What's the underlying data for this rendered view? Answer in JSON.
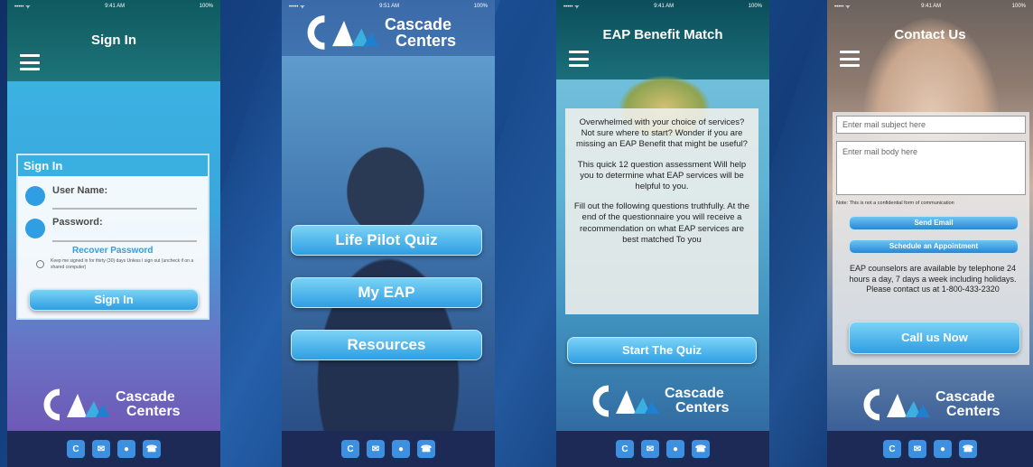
{
  "status_bar": {
    "signal": "••••• ᯤ",
    "battery": "100%",
    "times": [
      "9:41 AM",
      "9:51 AM",
      "9:41 AM",
      "9:41 AM"
    ]
  },
  "brand": {
    "line1": "Cascade",
    "line2": "Centers",
    "mark": "CA"
  },
  "tabbar_icons": [
    "cascade-icon",
    "mail-icon",
    "chat-icon",
    "phone-icon"
  ],
  "sign_in_screen": {
    "header_title": "Sign In",
    "panel_title": "Sign In",
    "username_label": "User Name:",
    "password_label": "Password:",
    "recover_link": "Recover Password",
    "keep_signed_in": "Keep me signed in for thirty (30) days Unless I sign out (uncheck if on a shared computer)",
    "sign_in_button": "Sign In"
  },
  "menu_screen": {
    "buttons": [
      "Life Pilot Quiz",
      "My EAP",
      "Resources"
    ]
  },
  "quiz_screen": {
    "header_title": "EAP Benefit Match",
    "para1": "Overwhelmed with your choice of services? Not sure where to start? Wonder if you are missing an EAP Benefit that might be useful?",
    "para2": "This quick 12 question assessment Will help you to determine what EAP services will be helpful to you.",
    "para3": "Fill out the following questions truthfully. At the end of the questionnaire you will receive a recommendation on what EAP services are best matched To you",
    "start_button": "Start The Quiz"
  },
  "contact_screen": {
    "header_title": "Contact Us",
    "subject_placeholder": "Enter mail subject here",
    "body_placeholder": "Enter mail body here",
    "note": "Note: This is not a confidential form of communication",
    "send_button": "Send Email",
    "schedule_button": "Schedule an Appointment",
    "availability": "EAP counselors are available by telephone 24 hours a day, 7 days a week including holidays. Please contact us at 1-800-433-2320",
    "call_button": "Call us Now"
  },
  "colors": {
    "accent": "#2f9ee3",
    "header_teal": "#1e6e73",
    "background": "#15417f"
  }
}
